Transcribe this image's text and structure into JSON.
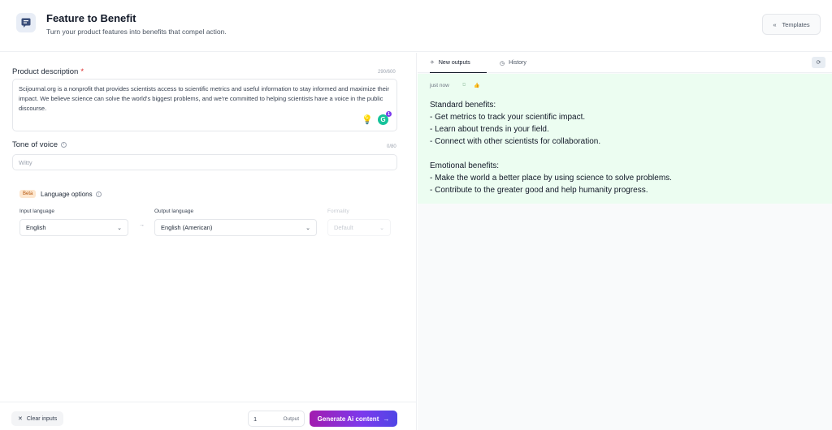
{
  "header": {
    "title": "Feature to Benefit",
    "subtitle": "Turn your product features into benefits that compel action.",
    "templates_label": "Templates",
    "icon": "chat-doc-icon"
  },
  "form": {
    "product_description": {
      "label": "Product description",
      "required_mark": "*",
      "counter": "290/600",
      "value": "Scijournal.org is a nonprofit that provides scientists access to scientific metrics and useful information to stay informed and maximize their impact. We believe science can solve the world's biggest problems, and we're committed to helping scientists have a voice in the public discourse.",
      "grammarly_badge": "1"
    },
    "tone_of_voice": {
      "label": "Tone of voice",
      "counter": "0/80",
      "placeholder": "Witty"
    },
    "language": {
      "beta_badge": "Beta",
      "title": "Language options",
      "input_label": "Input language",
      "input_value": "English",
      "arrow": "→",
      "output_label": "Output language",
      "output_value": "English (American)",
      "formality_label": "Formality",
      "formality_value": "Default"
    }
  },
  "footer": {
    "clear_label": "Clear inputs",
    "output_count": "1",
    "output_label": "Output",
    "generate_label": "Generate Ai content"
  },
  "right": {
    "tabs": [
      {
        "label": "New outputs",
        "icon": "sparkle-icon"
      },
      {
        "label": "History",
        "icon": "clock-icon"
      }
    ],
    "output": {
      "timestamp": "just now",
      "text": "Standard benefits:\n- Get metrics to track your scientific impact.\n- Learn about trends in your field.\n- Connect with other scientists for collaboration.\n\nEmotional benefits:\n- Make the world a better place by using science to solve problems.\n- Contribute to the greater good and help humanity progress."
    }
  },
  "colors": {
    "accent_gradient_start": "#a21caf",
    "accent_gradient_end": "#4f46e5",
    "output_bg": "#ecfdf1",
    "required": "#dc2626"
  }
}
